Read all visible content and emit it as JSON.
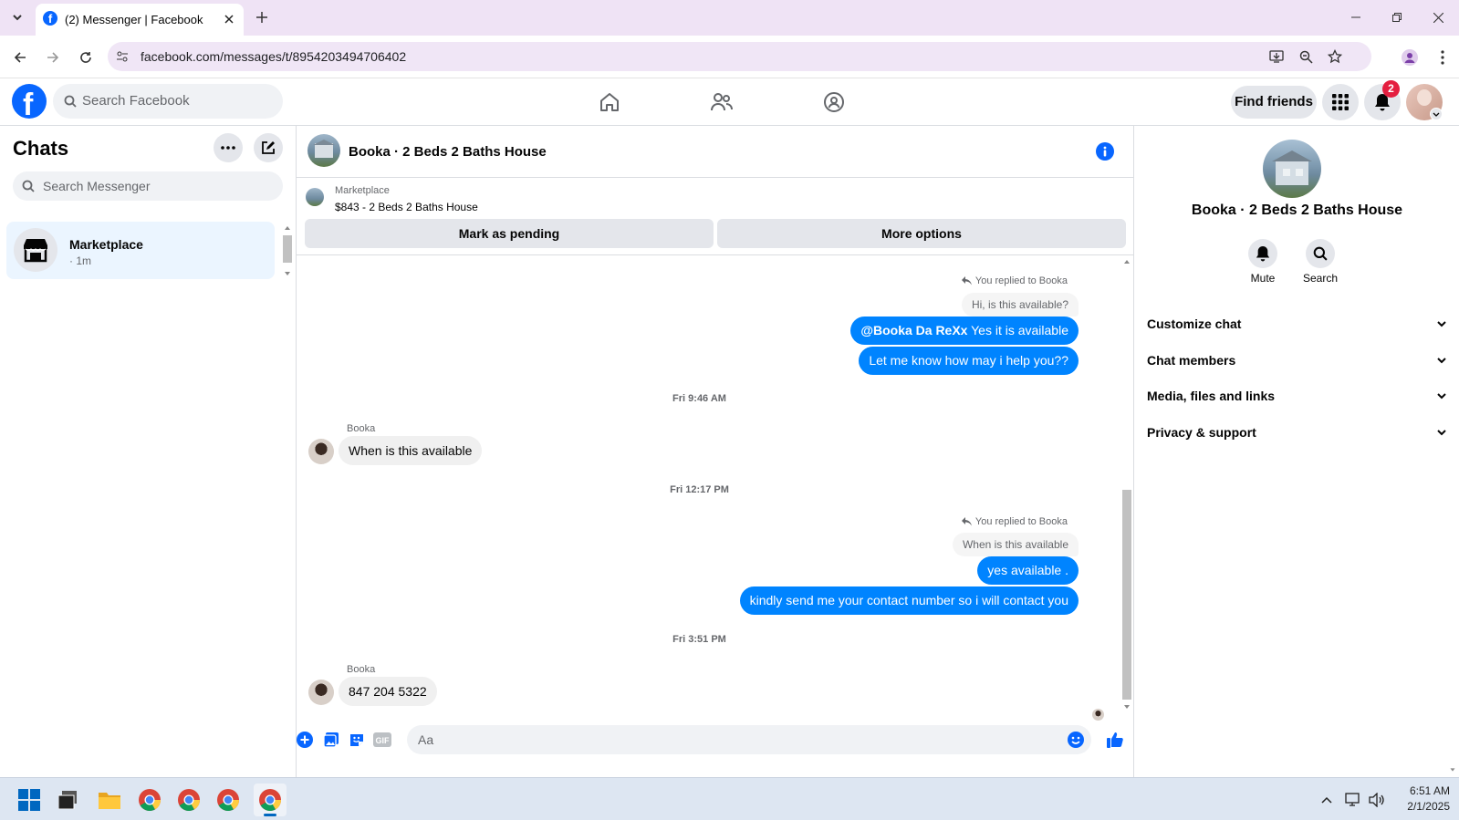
{
  "browser": {
    "tab_title": "(2) Messenger | Facebook",
    "url": "facebook.com/messages/t/8954203494706402"
  },
  "header": {
    "search_placeholder": "Search Facebook",
    "find_friends": "Find friends",
    "notification_count": "2"
  },
  "chats_panel": {
    "title": "Chats",
    "search_placeholder": "Search Messenger",
    "items": [
      {
        "name": "Marketplace",
        "meta": "· 1m"
      }
    ]
  },
  "conversation": {
    "title": "Booka · 2 Beds 2 Baths House",
    "listing": {
      "source": "Marketplace",
      "detail": "$843 - 2 Beds 2 Baths House"
    },
    "mark_pending": "Mark as pending",
    "more_options": "More options",
    "messages": {
      "reply1_label": "You replied to Booka",
      "reply1_quote": "Hi, is this available?",
      "out1_mention": "@Booka Da ReXx",
      "out1_text": " Yes it is available",
      "out2": "Let me know how may i help you??",
      "ts1": "Fri 9:46 AM",
      "in1_sender": "Booka",
      "in1": "When is this available",
      "ts2": "Fri 12:17 PM",
      "reply2_label": "You replied to Booka",
      "reply2_quote": "When is this available",
      "out3": "yes available .",
      "out4": "kindly send me your contact number so i will contact you",
      "ts3": "Fri 3:51 PM",
      "in2_sender": "Booka",
      "in2": "847 204 5322"
    },
    "composer_placeholder": "Aa"
  },
  "details_panel": {
    "title": "Booka · 2 Beds 2 Baths House",
    "mute": "Mute",
    "search": "Search",
    "sections": [
      "Customize chat",
      "Chat members",
      "Media, files and links",
      "Privacy & support"
    ]
  },
  "taskbar": {
    "time": "6:51 AM",
    "date": "2/1/2025"
  },
  "colors": {
    "accent": "#0084ff",
    "fb_blue": "#0866ff",
    "badge_red": "#e41e3f"
  }
}
